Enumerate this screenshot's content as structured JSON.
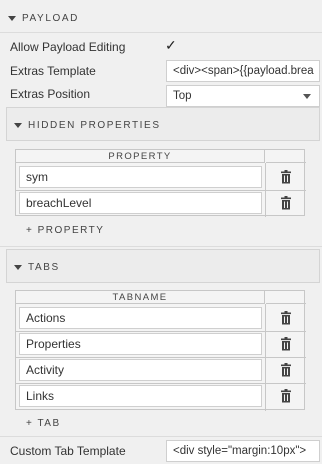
{
  "payload": {
    "header": "PAYLOAD",
    "allow_editing_label": "Allow Payload Editing",
    "allow_editing_checked": true,
    "extras_template_label": "Extras Template",
    "extras_template_value": "<div><span>{{payload.brea",
    "extras_position_label": "Extras Position",
    "extras_position_value": "Top"
  },
  "hidden_properties": {
    "header": "HIDDEN PROPERTIES",
    "column_header": "PROPERTY",
    "rows": [
      "sym",
      "breachLevel"
    ],
    "add_label": "+ PROPERTY"
  },
  "tabs": {
    "header": "TABS",
    "column_header": "TABNAME",
    "rows": [
      "Actions",
      "Properties",
      "Activity",
      "Links"
    ],
    "add_label": "+ TAB"
  },
  "custom_tab_template": {
    "label": "Custom Tab Template",
    "value": "<div style=\"margin:10px\">"
  },
  "icons": {
    "collapse": "caret-down-icon",
    "delete": "trash-icon",
    "dropdown": "chevron-down-icon",
    "check": "checkmark-icon"
  }
}
